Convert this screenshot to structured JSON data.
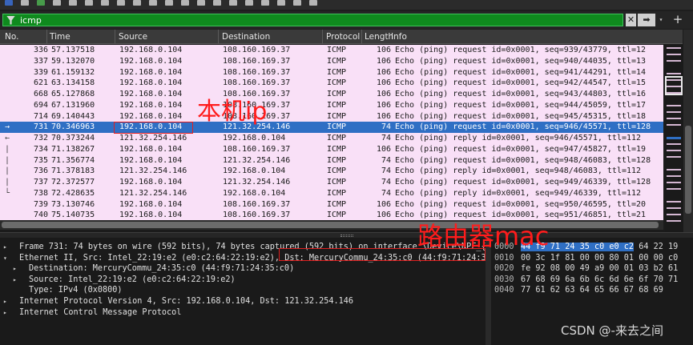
{
  "filter": {
    "value": "icmp"
  },
  "filter_buttons": {
    "clear": "✕",
    "apply": "➡",
    "dropdown": "▾",
    "add": "+"
  },
  "columns": [
    "No.",
    "Time",
    "Source",
    "Destination",
    "Protocol",
    "Length",
    "Info"
  ],
  "packets": [
    {
      "no": "336",
      "time": "57.137518",
      "src": "192.168.0.104",
      "dst": "108.160.169.37",
      "proto": "ICMP",
      "len": "106",
      "info": "Echo (ping) request  id=0x0001, seq=939/43779, ttl=12"
    },
    {
      "no": "337",
      "time": "59.132070",
      "src": "192.168.0.104",
      "dst": "108.160.169.37",
      "proto": "ICMP",
      "len": "106",
      "info": "Echo (ping) request  id=0x0001, seq=940/44035, ttl=13"
    },
    {
      "no": "339",
      "time": "61.159132",
      "src": "192.168.0.104",
      "dst": "108.160.169.37",
      "proto": "ICMP",
      "len": "106",
      "info": "Echo (ping) request  id=0x0001, seq=941/44291, ttl=14"
    },
    {
      "no": "621",
      "time": "63.134158",
      "src": "192.168.0.104",
      "dst": "108.160.169.37",
      "proto": "ICMP",
      "len": "106",
      "info": "Echo (ping) request  id=0x0001, seq=942/44547, ttl=15"
    },
    {
      "no": "668",
      "time": "65.127868",
      "src": "192.168.0.104",
      "dst": "108.160.169.37",
      "proto": "ICMP",
      "len": "106",
      "info": "Echo (ping) request  id=0x0001, seq=943/44803, ttl=16"
    },
    {
      "no": "694",
      "time": "67.131960",
      "src": "192.168.0.104",
      "dst": "108.160.169.37",
      "proto": "ICMP",
      "len": "106",
      "info": "Echo (ping) request  id=0x0001, seq=944/45059, ttl=17"
    },
    {
      "no": "714",
      "time": "69.140443",
      "src": "192.168.0.104",
      "dst": "108.160.169.37",
      "proto": "ICMP",
      "len": "106",
      "info": "Echo (ping) request  id=0x0001, seq=945/45315, ttl=18"
    },
    {
      "no": "731",
      "time": "70.346963",
      "src": "192.168.0.104",
      "dst": "121.32.254.146",
      "proto": "ICMP",
      "len": "74",
      "info": "Echo (ping) request  id=0x0001, seq=946/45571, ttl=128"
    },
    {
      "no": "732",
      "time": "70.373244",
      "src": "121.32.254.146",
      "dst": "192.168.0.104",
      "proto": "ICMP",
      "len": "74",
      "info": "Echo (ping) reply    id=0x0001, seq=946/45571, ttl=112"
    },
    {
      "no": "734",
      "time": "71.138267",
      "src": "192.168.0.104",
      "dst": "108.160.169.37",
      "proto": "ICMP",
      "len": "106",
      "info": "Echo (ping) request  id=0x0001, seq=947/45827, ttl=19"
    },
    {
      "no": "735",
      "time": "71.356774",
      "src": "192.168.0.104",
      "dst": "121.32.254.146",
      "proto": "ICMP",
      "len": "74",
      "info": "Echo (ping) request  id=0x0001, seq=948/46083, ttl=128"
    },
    {
      "no": "736",
      "time": "71.378183",
      "src": "121.32.254.146",
      "dst": "192.168.0.104",
      "proto": "ICMP",
      "len": "74",
      "info": "Echo (ping) reply    id=0x0001, seq=948/46083, ttl=112"
    },
    {
      "no": "737",
      "time": "72.372577",
      "src": "192.168.0.104",
      "dst": "121.32.254.146",
      "proto": "ICMP",
      "len": "74",
      "info": "Echo (ping) request  id=0x0001, seq=949/46339, ttl=128"
    },
    {
      "no": "738",
      "time": "72.428635",
      "src": "121.32.254.146",
      "dst": "192.168.0.104",
      "proto": "ICMP",
      "len": "74",
      "info": "Echo (ping) reply    id=0x0001, seq=949/46339, ttl=112"
    },
    {
      "no": "739",
      "time": "73.130746",
      "src": "192.168.0.104",
      "dst": "108.160.169.37",
      "proto": "ICMP",
      "len": "106",
      "info": "Echo (ping) request  id=0x0001, seq=950/46595, ttl=20"
    },
    {
      "no": "740",
      "time": "75.140735",
      "src": "192.168.0.104",
      "dst": "108.160.169.37",
      "proto": "ICMP",
      "len": "106",
      "info": "Echo (ping) request  id=0x0001, seq=951/46851, ttl=21"
    }
  ],
  "selected_packet": "731",
  "details": [
    {
      "arrow": "▸",
      "indent": 0,
      "text": "Frame 731: 74 bytes on wire (592 bits), 74 bytes captured (592 bits) on interface \\Device\\NPF_{..."
    },
    {
      "arrow": "▾",
      "indent": 0,
      "text": "Ethernet II, Src: Intel_22:19:e2 (e0:c2:64:22:19:e2), Dst: MercuryCommu_24:35:c0 (44:f9:71:24:35:c0)"
    },
    {
      "arrow": "▸",
      "indent": 1,
      "text": "Destination: MercuryCommu_24:35:c0 (44:f9:71:24:35:c0)"
    },
    {
      "arrow": "▸",
      "indent": 1,
      "text": "Source: Intel_22:19:e2 (e0:c2:64:22:19:e2)"
    },
    {
      "arrow": "",
      "indent": 1,
      "text": "Type: IPv4 (0x0800)"
    },
    {
      "arrow": "▸",
      "indent": 0,
      "text": "Internet Protocol Version 4, Src: 192.168.0.104, Dst: 121.32.254.146"
    },
    {
      "arrow": "▸",
      "indent": 0,
      "text": "Internet Control Message Protocol"
    }
  ],
  "bytes": [
    {
      "off": "0000",
      "hl": "44 f9 71 24 35 c0 e0 c2",
      "rest": " 64 22 19"
    },
    {
      "off": "0010",
      "hl": "",
      "rest": "00 3c 1f 81 00 00 80 01  00 00 c0"
    },
    {
      "off": "0020",
      "hl": "",
      "rest": "fe 92 08 00 49 a9 00 01  03 b2 61"
    },
    {
      "off": "0030",
      "hl": "",
      "rest": "67 68 69 6a 6b 6c 6d 6e  6f 70 71"
    },
    {
      "off": "0040",
      "hl": "",
      "rest": "77 61 62 63 64 65 66 67  68 69"
    }
  ],
  "annotations": {
    "local_ip": "本机ip",
    "router_mac": "路由器mac"
  },
  "watermark": "CSDN @-来去之间",
  "colors": {
    "row_bg": "#f9e0f7",
    "selected_bg": "#2f6fc4",
    "filter_bg": "#0f8a1e",
    "annotation": "#ff1c1c"
  }
}
